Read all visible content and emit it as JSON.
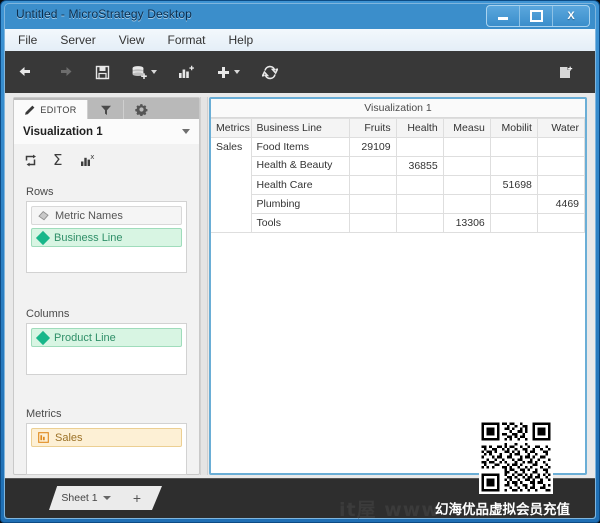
{
  "window": {
    "title": "Untitled - MicroStrategy Desktop",
    "controls": {
      "minimize": "–",
      "maximize": "□",
      "close": "X"
    }
  },
  "menubar": {
    "items": [
      {
        "label": "File"
      },
      {
        "label": "Server"
      },
      {
        "label": "View"
      },
      {
        "label": "Format"
      },
      {
        "label": "Help"
      }
    ]
  },
  "toolbar": {
    "buttons": [
      {
        "name": "undo",
        "icon": "undo-arrow-icon"
      },
      {
        "name": "redo",
        "icon": "redo-arrow-icon"
      },
      {
        "name": "save",
        "icon": "floppy-disk-icon"
      },
      {
        "name": "add-data",
        "icon": "database-add-icon"
      },
      {
        "name": "add-visualization",
        "icon": "bar-chart-add-icon"
      },
      {
        "name": "insert",
        "icon": "plus-icon"
      },
      {
        "name": "refresh",
        "icon": "refresh-icon"
      },
      {
        "name": "new-document",
        "icon": "document-add-icon"
      }
    ]
  },
  "editor_panel": {
    "tabs": [
      {
        "label": "EDITOR",
        "icon": "pencil-icon",
        "active": true
      },
      {
        "label": "",
        "icon": "filter-funnel-icon",
        "active": false
      },
      {
        "label": "",
        "icon": "gear-icon",
        "active": false
      }
    ],
    "visualization_select": {
      "value": "Visualization 1"
    },
    "icon_row": [
      {
        "name": "swap-rows-columns",
        "icon": "swap-arrow-icon"
      },
      {
        "name": "totals",
        "icon": "sigma-icon"
      },
      {
        "name": "metrics-format",
        "icon": "bar-chart-x-icon"
      }
    ],
    "shelves": [
      {
        "title": "Rows",
        "items": [
          {
            "label": "Metric Names",
            "style": "gray",
            "icon": "tag-icon"
          },
          {
            "label": "Business Line",
            "style": "green",
            "icon": "attribute-diamond-icon"
          }
        ]
      },
      {
        "title": "Columns",
        "items": [
          {
            "label": "Product Line",
            "style": "green",
            "icon": "attribute-diamond-icon"
          }
        ]
      },
      {
        "title": "Metrics",
        "items": [
          {
            "label": "Sales",
            "style": "orange",
            "icon": "metric-icon"
          }
        ]
      }
    ]
  },
  "visualization": {
    "title": "Visualization 1",
    "headers": [
      "Metrics",
      "Business Line",
      "Fruits",
      "Health",
      "Measu",
      "Mobilit",
      "Water"
    ],
    "rows": [
      {
        "metric": "Sales",
        "business_line": "Food Items",
        "values": [
          "29109",
          "",
          "",
          "",
          ""
        ]
      },
      {
        "metric": "",
        "business_line": "Health & Beauty",
        "values": [
          "",
          "36855",
          "",
          "",
          ""
        ]
      },
      {
        "metric": "",
        "business_line": "Health Care",
        "values": [
          "",
          "",
          "",
          "51698",
          ""
        ]
      },
      {
        "metric": "",
        "business_line": "Plumbing",
        "values": [
          "",
          "",
          "",
          "",
          "4469"
        ]
      },
      {
        "metric": "",
        "business_line": "Tools",
        "values": [
          "",
          "",
          "13306",
          "",
          ""
        ]
      }
    ]
  },
  "sheetbar": {
    "sheet_tab": "Sheet 1",
    "add_label": "+"
  },
  "watermarks": {
    "latin": "it屋  www",
    "chinese": "幻海优品虚拟会员充值"
  },
  "colors": {
    "accent_blue": "#3b8ecb",
    "attribute_green": "#18b78a",
    "metric_orange": "#e08a1e",
    "toolbar_dark": "#383838"
  }
}
